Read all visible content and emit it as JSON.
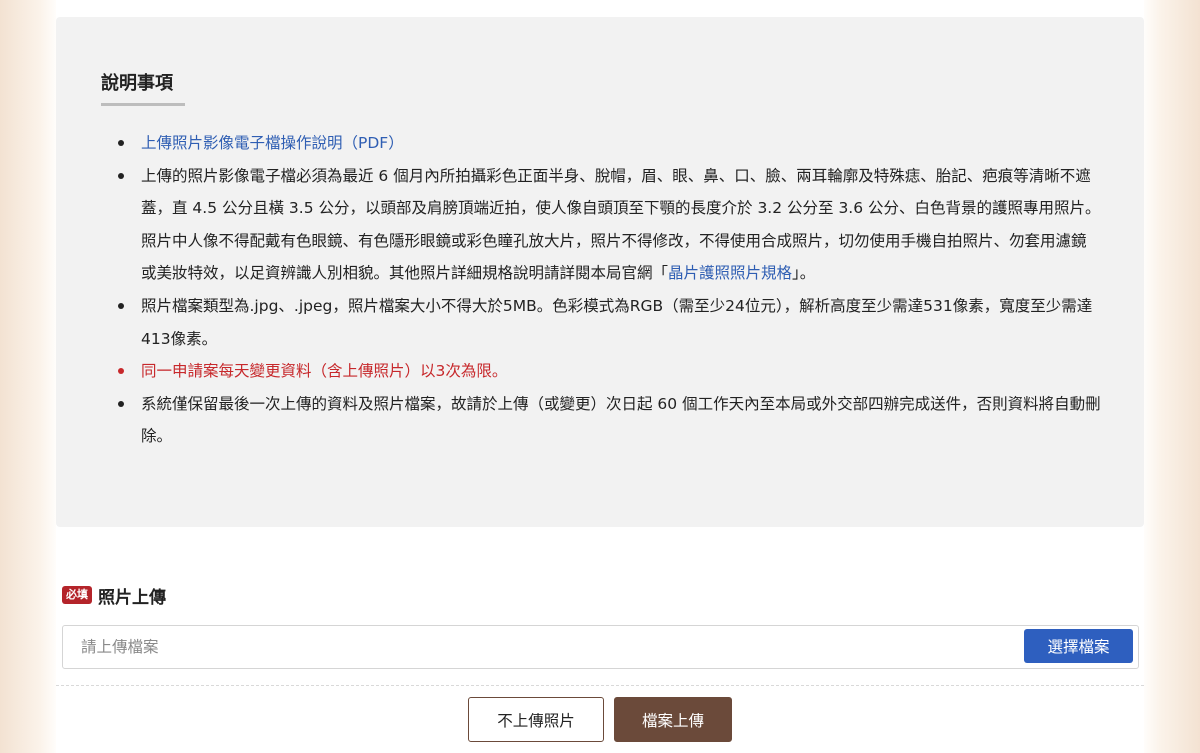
{
  "notice": {
    "title": "說明事項",
    "items": [
      {
        "type": "link",
        "text": "上傳照片影像電子檔操作說明（PDF）"
      },
      {
        "type": "text",
        "before": "上傳的照片影像電子檔必須為最近 6 個月內所拍攝彩色正面半身、脫帽，眉、眼、鼻、口、臉、兩耳輪廓及特殊痣、胎記、疤痕等清晰不遮蓋，直 4.5 公分且橫 3.5 公分，以頭部及肩膀頂端近拍，使人像自頭頂至下顎的長度介於 3.2 公分至 3.6 公分、白色背景的護照專用照片。照片中人像不得配戴有色眼鏡、有色隱形眼鏡或彩色瞳孔放大片，照片不得修改，不得使用合成照片，切勿使用手機自拍照片、勿套用濾鏡或美妝特效，以足資辨識人別相貌。其他照片詳細規格說明請詳閱本局官網「",
        "link": "晶片護照照片規格",
        "after": "」。"
      },
      {
        "type": "text",
        "text": "照片檔案類型為.jpg、.jpeg，照片檔案大小不得大於5MB。色彩模式為RGB（需至少24位元），解析高度至少需達531像素，寬度至少需達413像素。"
      },
      {
        "type": "warning",
        "text": "同一申請案每天變更資料（含上傳照片）以3次為限。"
      },
      {
        "type": "text",
        "text": "系統僅保留最後一次上傳的資料及照片檔案，故請於上傳（或變更）次日起 60 個工作天內至本局或外交部四辦完成送件，否則資料將自動刪除。"
      }
    ]
  },
  "upload": {
    "required_badge": "必填",
    "label": "照片上傳",
    "placeholder": "請上傳檔案",
    "value": "",
    "choose_button": "選擇檔案"
  },
  "actions": {
    "skip_label": "不上傳照片",
    "upload_label": "檔案上傳"
  },
  "colors": {
    "panel_bg": "#f2f2f2",
    "link": "#2f5eb3",
    "warning": "#c7282b",
    "required_badge": "#b4242a",
    "primary_blue": "#2e5fbf",
    "brown": "#6b4a3a"
  }
}
